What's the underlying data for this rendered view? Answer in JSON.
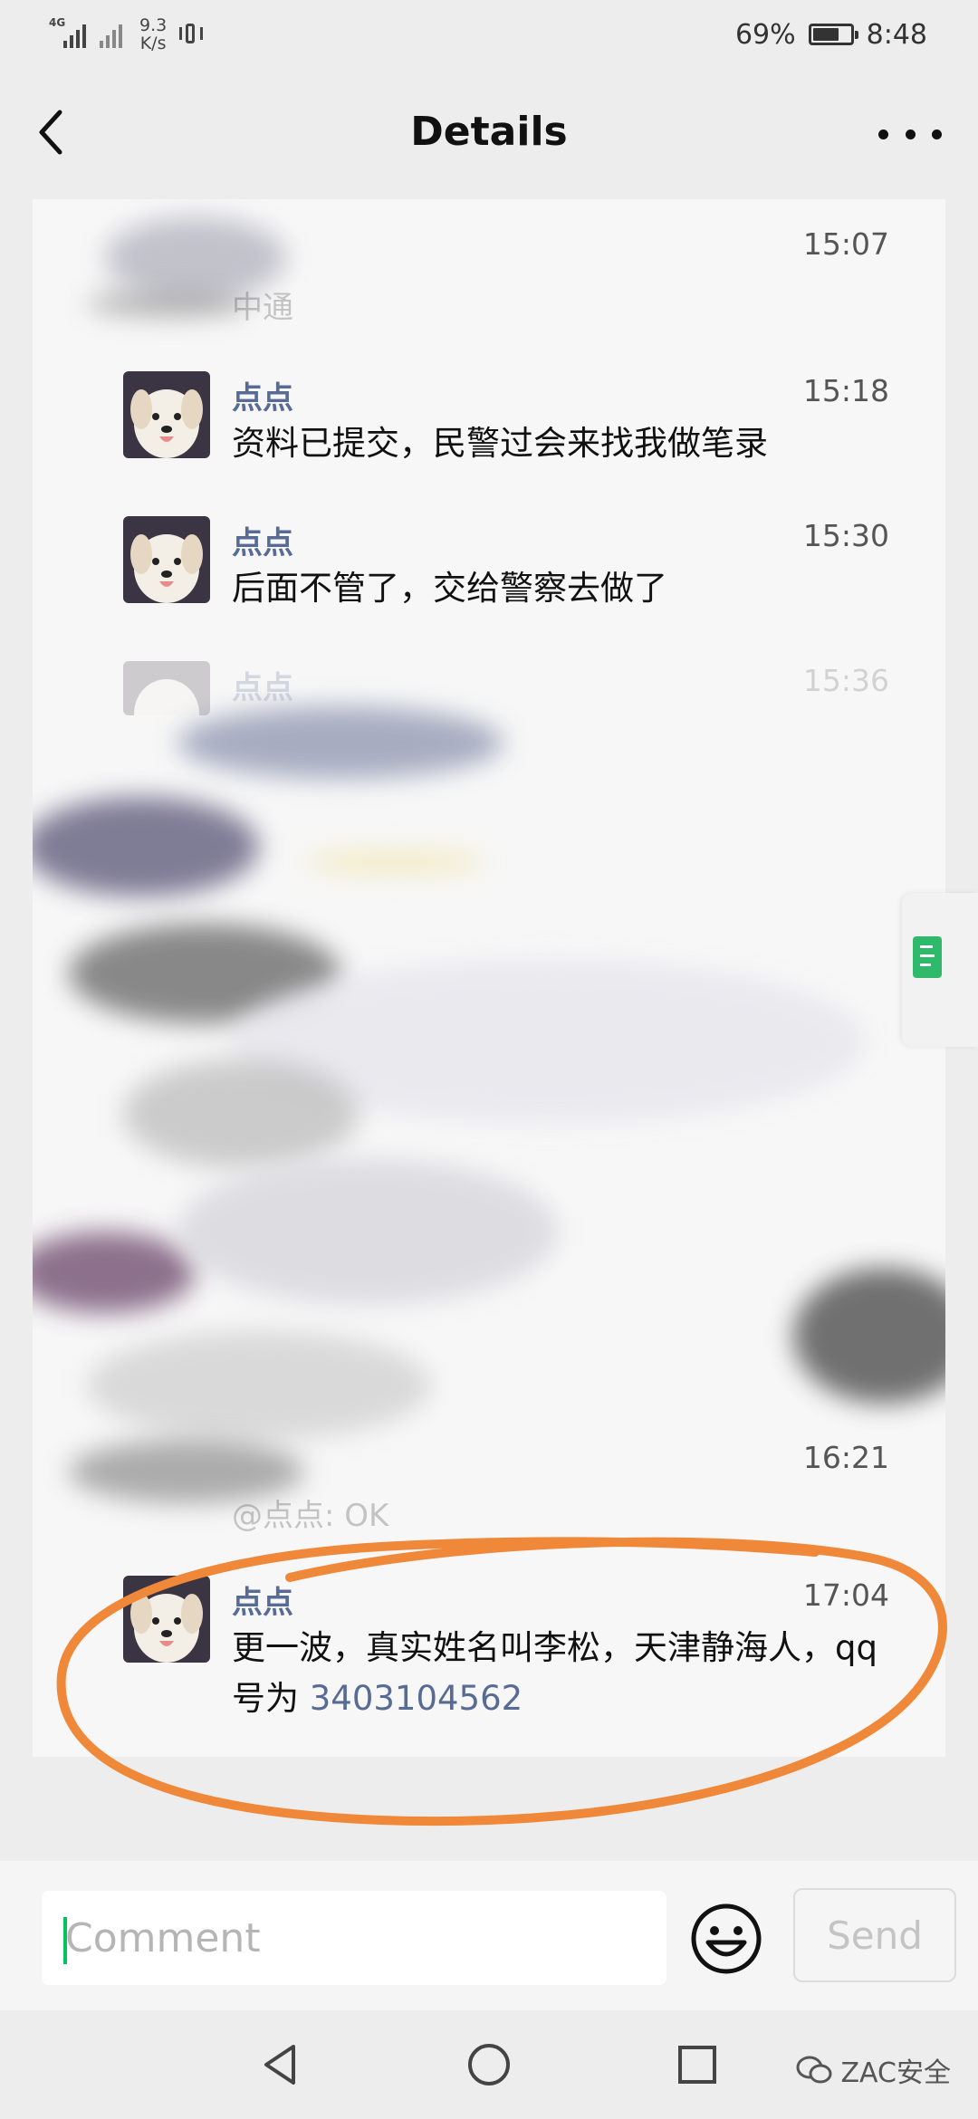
{
  "status_bar": {
    "network_tag": "4G",
    "speed_value": "9.3",
    "speed_unit": "K/s",
    "battery_percent": "69%",
    "battery_level": 0.69,
    "time": "8:48"
  },
  "header": {
    "title": "Details"
  },
  "feed": {
    "obscured_top_time": "15:07",
    "obscured_top_text_fragment": "中通",
    "messages": [
      {
        "nickname": "点点",
        "time": "15:18",
        "text": "资料已提交，民警过会来找我做笔录"
      },
      {
        "nickname": "点点",
        "time": "15:30",
        "text": "后面不管了，交给警察去做了"
      },
      {
        "nickname": "点点",
        "time": "15:36",
        "text": ""
      }
    ],
    "obscured_time_2": "16:21",
    "obscured_text_2": "@点点: OK",
    "last_message": {
      "nickname": "点点",
      "time": "17:04",
      "text_prefix": "更一波，真实姓名叫李松，天津静海人，qq号为 ",
      "qq_number": "3403104562"
    }
  },
  "comment_bar": {
    "placeholder": "Comment",
    "send_label": "Send"
  },
  "watermark": {
    "text": "ZAC安全"
  },
  "colors": {
    "nickname": "#576b95",
    "annotation": "#f0883a",
    "accent_green": "#07c160"
  },
  "icons": [
    "back-arrow-icon",
    "more-dots-icon",
    "emoji-icon",
    "nav-back-icon",
    "nav-home-icon",
    "nav-recents-icon",
    "wechat-icon"
  ]
}
